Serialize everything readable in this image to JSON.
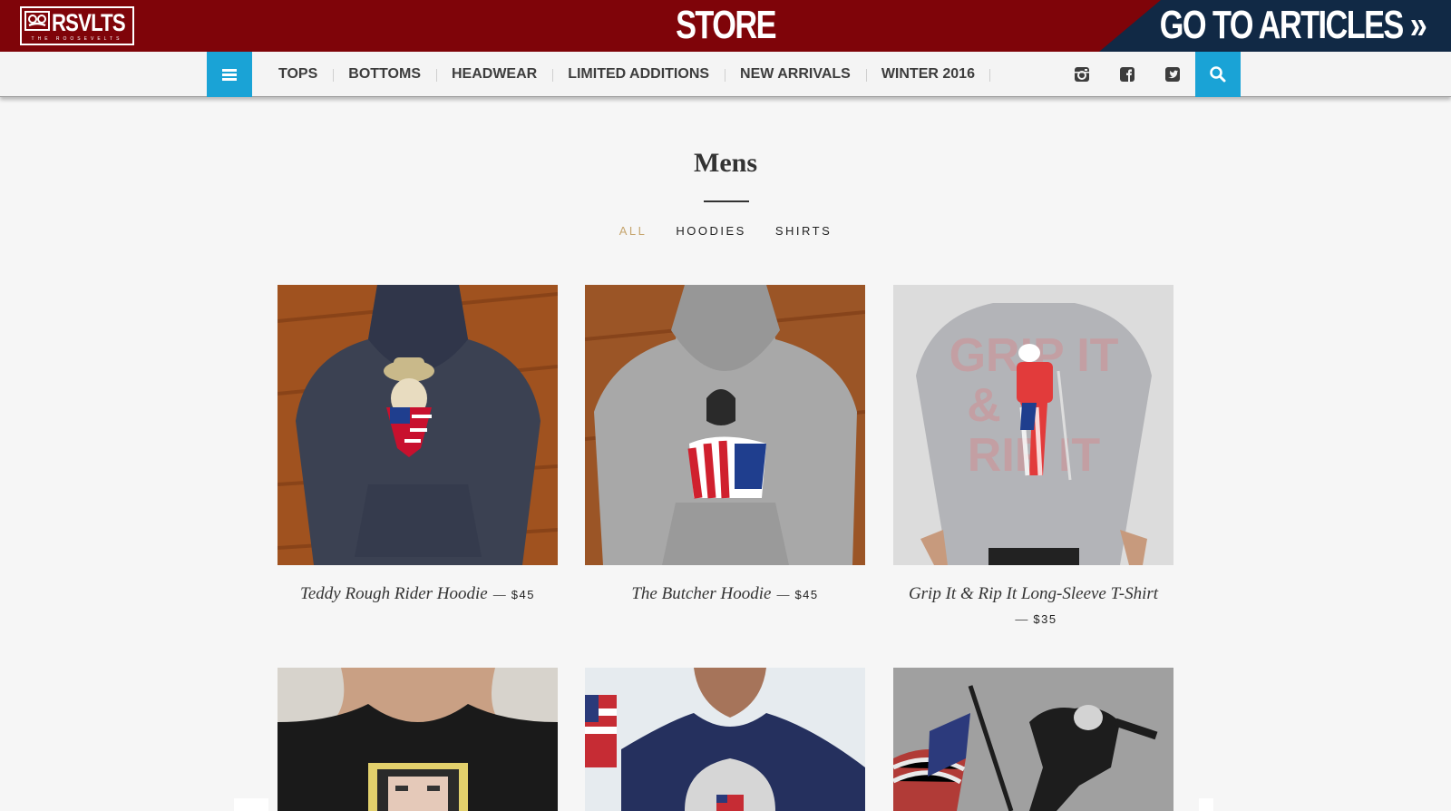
{
  "header": {
    "logo_text": "RSVLTS",
    "logo_subtitle": "THE ROOSEVELTS",
    "store_title": "STORE",
    "articles_link": "GO TO ARTICLES »",
    "brand_color": "#7f0409",
    "articles_bg": "#112945"
  },
  "nav": {
    "accent_color": "#1aa3d6",
    "menu_icon": "hamburger-icon",
    "items": [
      "TOPS",
      "BOTTOMS",
      "HEADWEAR",
      "LIMITED ADDITIONS",
      "NEW ARRIVALS",
      "WINTER 2016"
    ],
    "social_icons": [
      "instagram-icon",
      "facebook-icon",
      "twitter-icon"
    ],
    "search_icon": "search-icon"
  },
  "page": {
    "title": "Mens",
    "filters": [
      "ALL",
      "HOODIES",
      "SHIRTS"
    ],
    "active_filter": "ALL"
  },
  "products": [
    {
      "name": "Teddy Rough Rider Hoodie",
      "separator": "—",
      "price": "$45"
    },
    {
      "name": "The Butcher Hoodie",
      "separator": "—",
      "price": "$45"
    },
    {
      "name": "Grip It & Rip It Long-Sleeve T-Shirt",
      "separator": "—",
      "price": "$35"
    },
    {
      "name": "",
      "separator": "",
      "price": ""
    },
    {
      "name": "",
      "separator": "",
      "price": ""
    },
    {
      "name": "",
      "separator": "",
      "price": ""
    }
  ]
}
